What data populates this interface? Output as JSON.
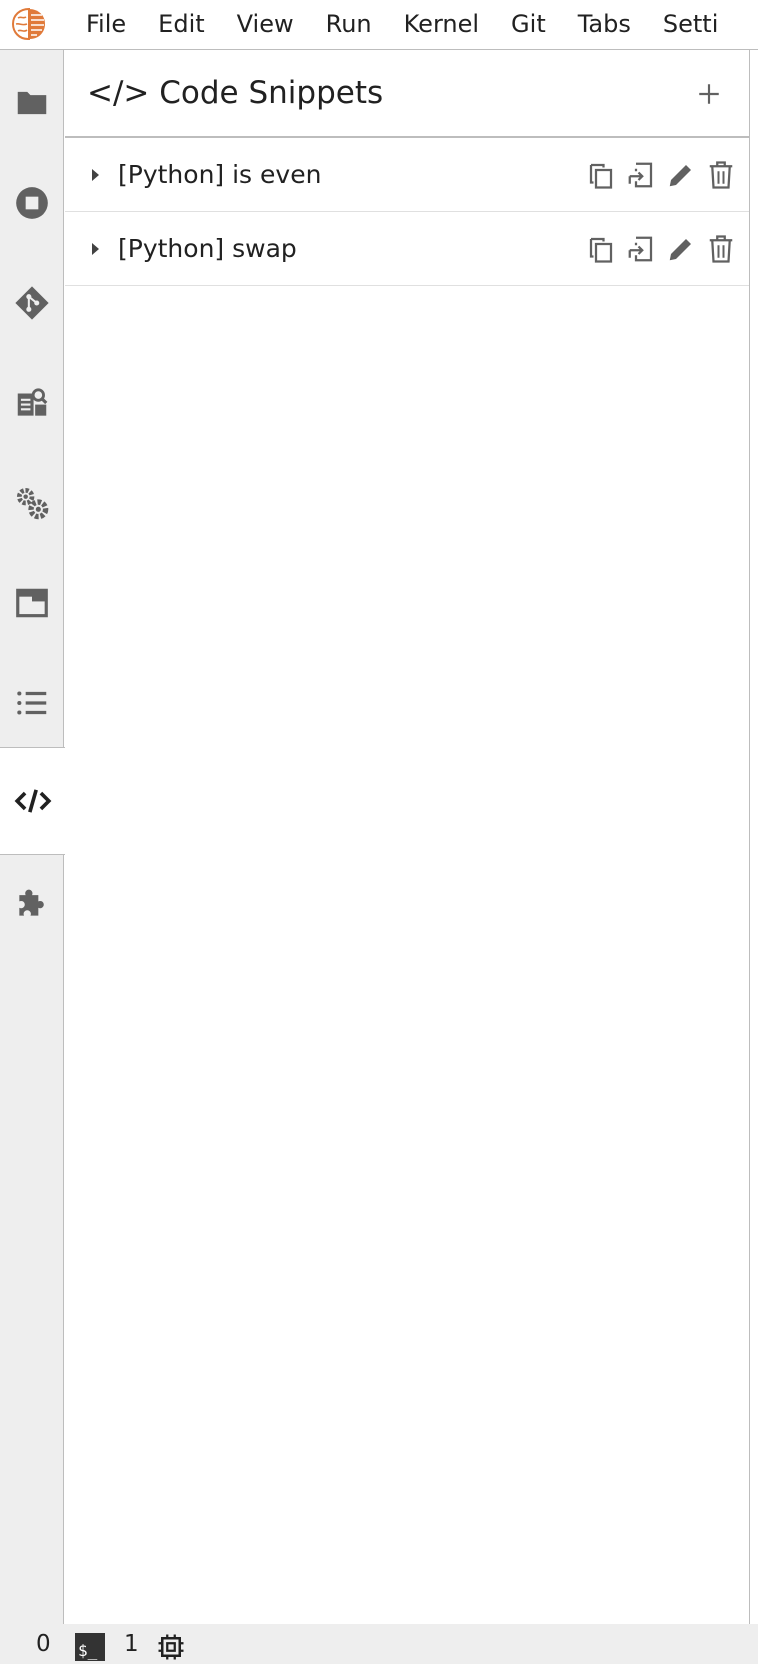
{
  "menubar": {
    "logo": "jupyter-brain-logo",
    "items": [
      "File",
      "Edit",
      "View",
      "Run",
      "Kernel",
      "Git",
      "Tabs",
      "Setti"
    ]
  },
  "sidebar": {
    "tabs": [
      {
        "icon": "folder-icon"
      },
      {
        "icon": "stop-circle-icon"
      },
      {
        "icon": "git-icon"
      },
      {
        "icon": "property-inspector-icon"
      },
      {
        "icon": "settings-gears-icon"
      },
      {
        "icon": "tab-window-icon"
      },
      {
        "icon": "table-of-contents-icon"
      },
      {
        "icon": "code-snippet-icon",
        "active": true
      },
      {
        "icon": "extension-puzzle-icon"
      }
    ]
  },
  "panel": {
    "title": "</> Code Snippets",
    "snippets": [
      {
        "label": "[Python] is even"
      },
      {
        "label": "[Python] swap"
      }
    ]
  },
  "statusbar": {
    "kernels": "0",
    "terminal_icon_text": "$_",
    "terminals": "1"
  },
  "colors": {
    "sidebar_bg": "#eeeeee",
    "icon": "#616161",
    "logo_orange": "#e07a3a",
    "border": "#bdbdbd"
  }
}
